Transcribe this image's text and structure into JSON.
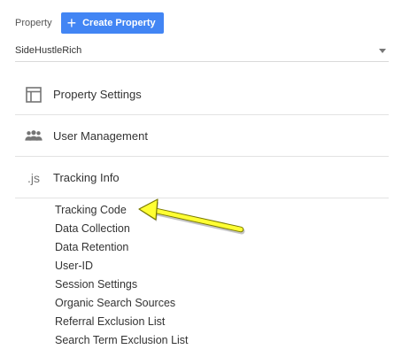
{
  "header": {
    "property_label": "Property",
    "create_button_label": "Create Property"
  },
  "property_select": {
    "value": "SideHustleRich"
  },
  "sections": [
    {
      "label": "Property Settings",
      "icon": "layout-icon"
    },
    {
      "label": "User Management",
      "icon": "people-icon"
    },
    {
      "label": "Tracking Info",
      "icon_text": ".js"
    }
  ],
  "tracking_items": [
    "Tracking Code",
    "Data Collection",
    "Data Retention",
    "User-ID",
    "Session Settings",
    "Organic Search Sources",
    "Referral Exclusion List",
    "Search Term Exclusion List"
  ],
  "colors": {
    "accent": "#4285f4",
    "arrow": "#ffff33"
  }
}
